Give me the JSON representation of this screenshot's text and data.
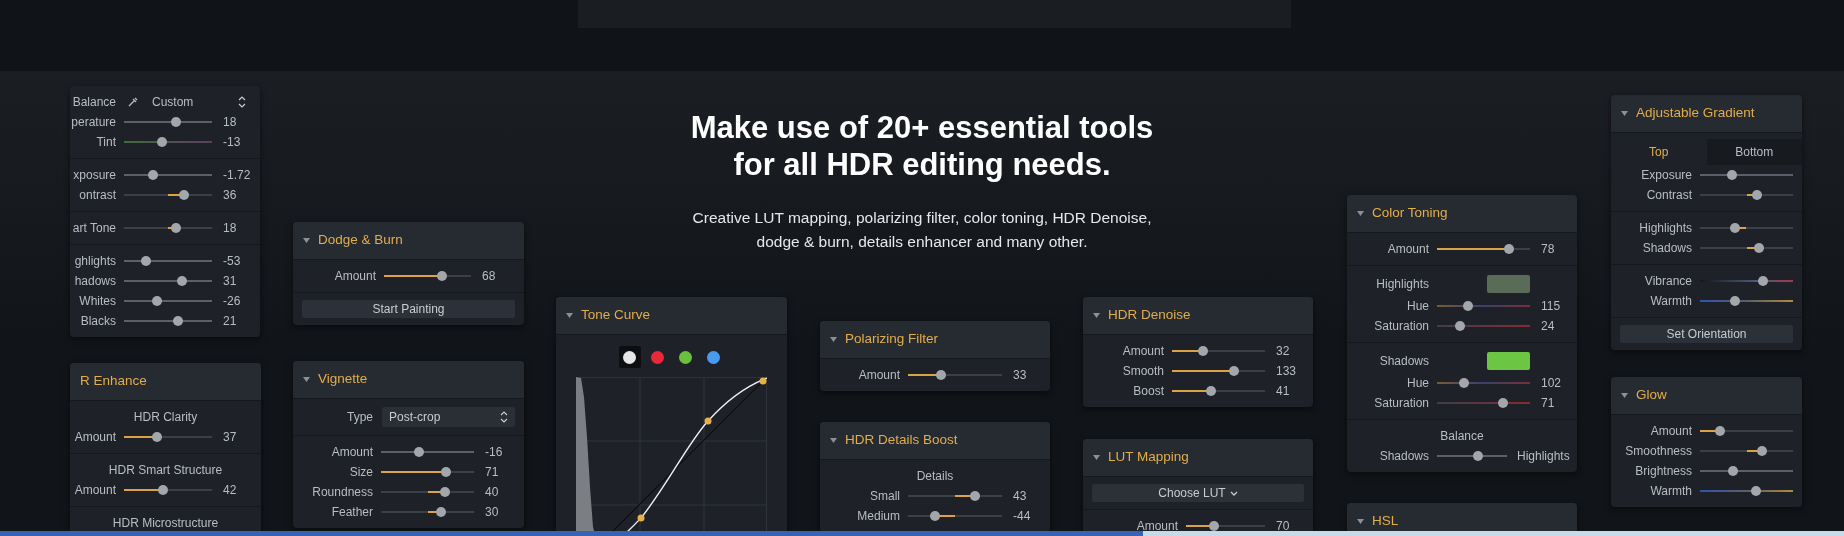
{
  "headline": [
    "Make use of 20+ essential tools",
    "for all HDR editing needs."
  ],
  "subtitle": [
    "Creative LUT mapping, polarizing filter, color toning, HDR Denoise,",
    "dodge & burn, details enhancer and many other."
  ],
  "panels": [
    {
      "sections": [
        [
          {
            "kind": "mode",
            "label": "Balance",
            "value": "Custom"
          },
          {
            "kind": "plain",
            "label": "perature",
            "level": 0.59,
            "value": "18"
          },
          {
            "kind": "tint",
            "label": "Tint",
            "level": 0.43,
            "value": "-13"
          }
        ],
        [
          {
            "kind": "plain",
            "label": "xposure",
            "level": 0.33,
            "value": "-1.72"
          },
          {
            "kind": "bipolar",
            "label": "ontrast",
            "level": 0.68,
            "value": "36"
          }
        ],
        [
          {
            "kind": "bipolar",
            "label": "art Tone",
            "level": 0.59,
            "value": "18"
          }
        ],
        [
          {
            "kind": "plain",
            "label": "ghlights",
            "level": 0.25,
            "value": "-53"
          },
          {
            "kind": "plain",
            "label": "hadows",
            "level": 0.66,
            "value": "31"
          },
          {
            "kind": "plain",
            "label": "Whites",
            "level": 0.37,
            "value": "-26"
          },
          {
            "kind": "plain",
            "label": "Blacks",
            "level": 0.61,
            "value": "21"
          }
        ]
      ]
    },
    {
      "title": "R Enhance",
      "caret": false,
      "sections": [
        [
          {
            "kind": "heading",
            "text": "HDR Clarity"
          },
          {
            "kind": "slider",
            "label": "Amount",
            "level": 0.38,
            "value": "37"
          }
        ],
        [
          {
            "kind": "heading",
            "text": "HDR Smart Structure"
          },
          {
            "kind": "slider",
            "label": "Amount",
            "level": 0.44,
            "value": "42"
          }
        ],
        [
          {
            "kind": "heading",
            "text": "HDR Microstructure"
          }
        ]
      ]
    },
    {
      "title": "Dodge & Burn",
      "caret": true,
      "sections": [
        [
          {
            "kind": "slider",
            "label": "Amount",
            "level": 0.67,
            "value": "68"
          }
        ],
        [
          {
            "kind": "button",
            "label": "Start Painting",
            "menu": false
          }
        ]
      ]
    },
    {
      "title": "Vignette",
      "caret": true,
      "sections": [
        [
          {
            "kind": "select",
            "label": "Type",
            "value": "Post-crop"
          }
        ],
        [
          {
            "kind": "plain",
            "label": "Amount",
            "level": 0.41,
            "value": "-16"
          },
          {
            "kind": "slider",
            "label": "Size",
            "level": 0.7,
            "value": "71"
          },
          {
            "kind": "bipolar",
            "label": "Roundness",
            "level": 0.69,
            "value": "40"
          },
          {
            "kind": "bipolar",
            "label": "Feather",
            "level": 0.65,
            "value": "30"
          }
        ]
      ]
    },
    {
      "title": "Tone Curve",
      "caret": true,
      "sections": [
        [
          {
            "kind": "curve",
            "channels": [
              {
                "color": "#e6e6e6",
                "selected": true
              },
              {
                "color": "#e8293a",
                "selected": false
              },
              {
                "color": "#6abf3f",
                "selected": false
              },
              {
                "color": "#4a9af0",
                "selected": false
              }
            ]
          }
        ]
      ]
    },
    {
      "title": "Polarizing Filter",
      "caret": true,
      "sections": [
        [
          {
            "kind": "slider",
            "label": "Amount",
            "level": 0.35,
            "value": "33"
          }
        ]
      ]
    },
    {
      "title": "HDR Details Boost",
      "caret": true,
      "sections": [
        [
          {
            "kind": "heading",
            "text": "Details"
          },
          {
            "kind": "bipolar",
            "label": "Small",
            "level": 0.71,
            "value": "43"
          },
          {
            "kind": "bipolar",
            "label": "Medium",
            "level": 0.29,
            "value": "-44"
          }
        ]
      ]
    },
    {
      "title": "HDR Denoise",
      "caret": true,
      "sections": [
        [
          {
            "kind": "slider",
            "label": "Amount",
            "level": 0.33,
            "value": "32"
          },
          {
            "kind": "slider",
            "label": "Smooth",
            "level": 0.67,
            "value": "133"
          },
          {
            "kind": "slider",
            "label": "Boost",
            "level": 0.42,
            "value": "41"
          }
        ]
      ]
    },
    {
      "title": "LUT Mapping",
      "caret": true,
      "sections": [
        [
          {
            "kind": "button",
            "label": "Choose LUT",
            "menu": true
          }
        ],
        [
          {
            "kind": "slider",
            "label": "Amount",
            "level": 0.35,
            "value": "70"
          }
        ]
      ]
    },
    {
      "title": "Color Toning",
      "caret": true,
      "sections": [
        [
          {
            "kind": "slider",
            "label": "Amount",
            "level": 0.77,
            "value": "78"
          }
        ],
        [
          {
            "kind": "swatch",
            "label": "Highlights",
            "color": "#5a6b58"
          },
          {
            "kind": "hue",
            "label": "Hue",
            "level": 0.33,
            "value": "115"
          },
          {
            "kind": "saturation",
            "label": "Saturation",
            "level": 0.25,
            "value": "24"
          }
        ],
        [
          {
            "kind": "swatch",
            "label": "Shadows",
            "color": "#6cc644"
          },
          {
            "kind": "hue",
            "label": "Hue",
            "level": 0.29,
            "value": "102"
          },
          {
            "kind": "saturation",
            "label": "Saturation",
            "level": 0.71,
            "value": "71"
          }
        ],
        [
          {
            "kind": "heading",
            "text": "Balance"
          },
          {
            "kind": "balance",
            "left": "Shadows",
            "right": "Highlights",
            "level": 0.58
          }
        ]
      ]
    },
    {
      "title": "HSL",
      "caret": true
    },
    {
      "title": "Adjustable Gradient",
      "caret": true,
      "sections": [
        [
          {
            "kind": "tabs",
            "tabs": [
              {
                "label": "Top",
                "selected": true
              },
              {
                "label": "Bottom",
                "selected": false
              }
            ]
          },
          {
            "kind": "plain",
            "label": "Exposure",
            "level": 0.34
          },
          {
            "kind": "bipolar",
            "label": "Contrast",
            "level": 0.61
          }
        ],
        [
          {
            "kind": "bipolar",
            "label": "Highlights",
            "level": 0.38
          },
          {
            "kind": "bipolar",
            "label": "Shadows",
            "level": 0.63
          }
        ],
        [
          {
            "kind": "vibrance",
            "label": "Vibrance",
            "level": 0.68
          },
          {
            "kind": "warmth",
            "label": "Warmth",
            "level": 0.38
          }
        ],
        [
          {
            "kind": "button",
            "label": "Set Orientation",
            "menu": false
          }
        ]
      ]
    },
    {
      "title": "Glow",
      "caret": true,
      "sections": [
        [
          {
            "kind": "slider",
            "label": "Amount",
            "level": 0.21
          },
          {
            "kind": "bipolar",
            "label": "Smoothness",
            "level": 0.67
          },
          {
            "kind": "plain",
            "label": "Brightness",
            "level": 0.35
          },
          {
            "kind": "warmth",
            "label": "Warmth",
            "level": 0.6
          }
        ]
      ]
    }
  ]
}
